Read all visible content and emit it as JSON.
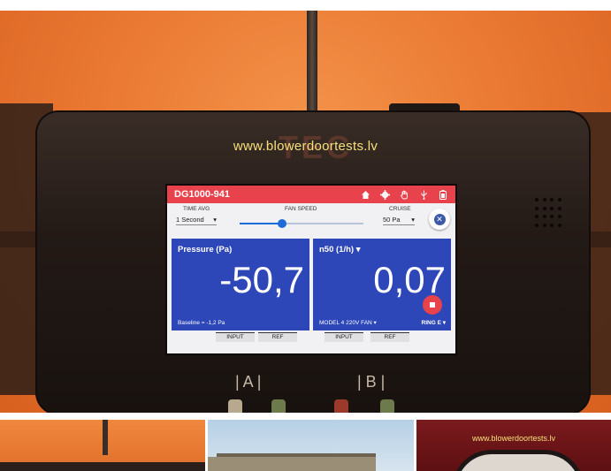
{
  "watermark": "www.blowerdoortests.lv",
  "device": {
    "id": "DG1000-941",
    "icons": [
      "home-icon",
      "gear-icon",
      "hand-icon",
      "usb-icon",
      "battery-icon"
    ],
    "time_avg": {
      "label": "TIME AVG",
      "value": "1 Second"
    },
    "fan_speed": {
      "label": "FAN SPEED",
      "level": 0.34
    },
    "cruise": {
      "label": "CRUISE",
      "value": "50 Pa"
    },
    "channel_a": {
      "label": "Pressure (Pa)",
      "value": "-50,7",
      "footer": "Baseline = -1,2 Pa"
    },
    "channel_b": {
      "label": "n50 (1/h)",
      "value": "0,07",
      "fan_model": "MODEL 4 220V FAN",
      "ring": "RING E"
    },
    "tabs": [
      "INPUT",
      "REF",
      "INPUT",
      "REF"
    ],
    "port_labels": {
      "a": "| A |",
      "b": "| B |"
    }
  },
  "thumbnail_watermark": "www.blowerdoortests.lv",
  "colors": {
    "topbar": "#e8424d",
    "panel": "#2d46b8",
    "watermark": "#f5e07a",
    "background": "#ea7a34"
  }
}
